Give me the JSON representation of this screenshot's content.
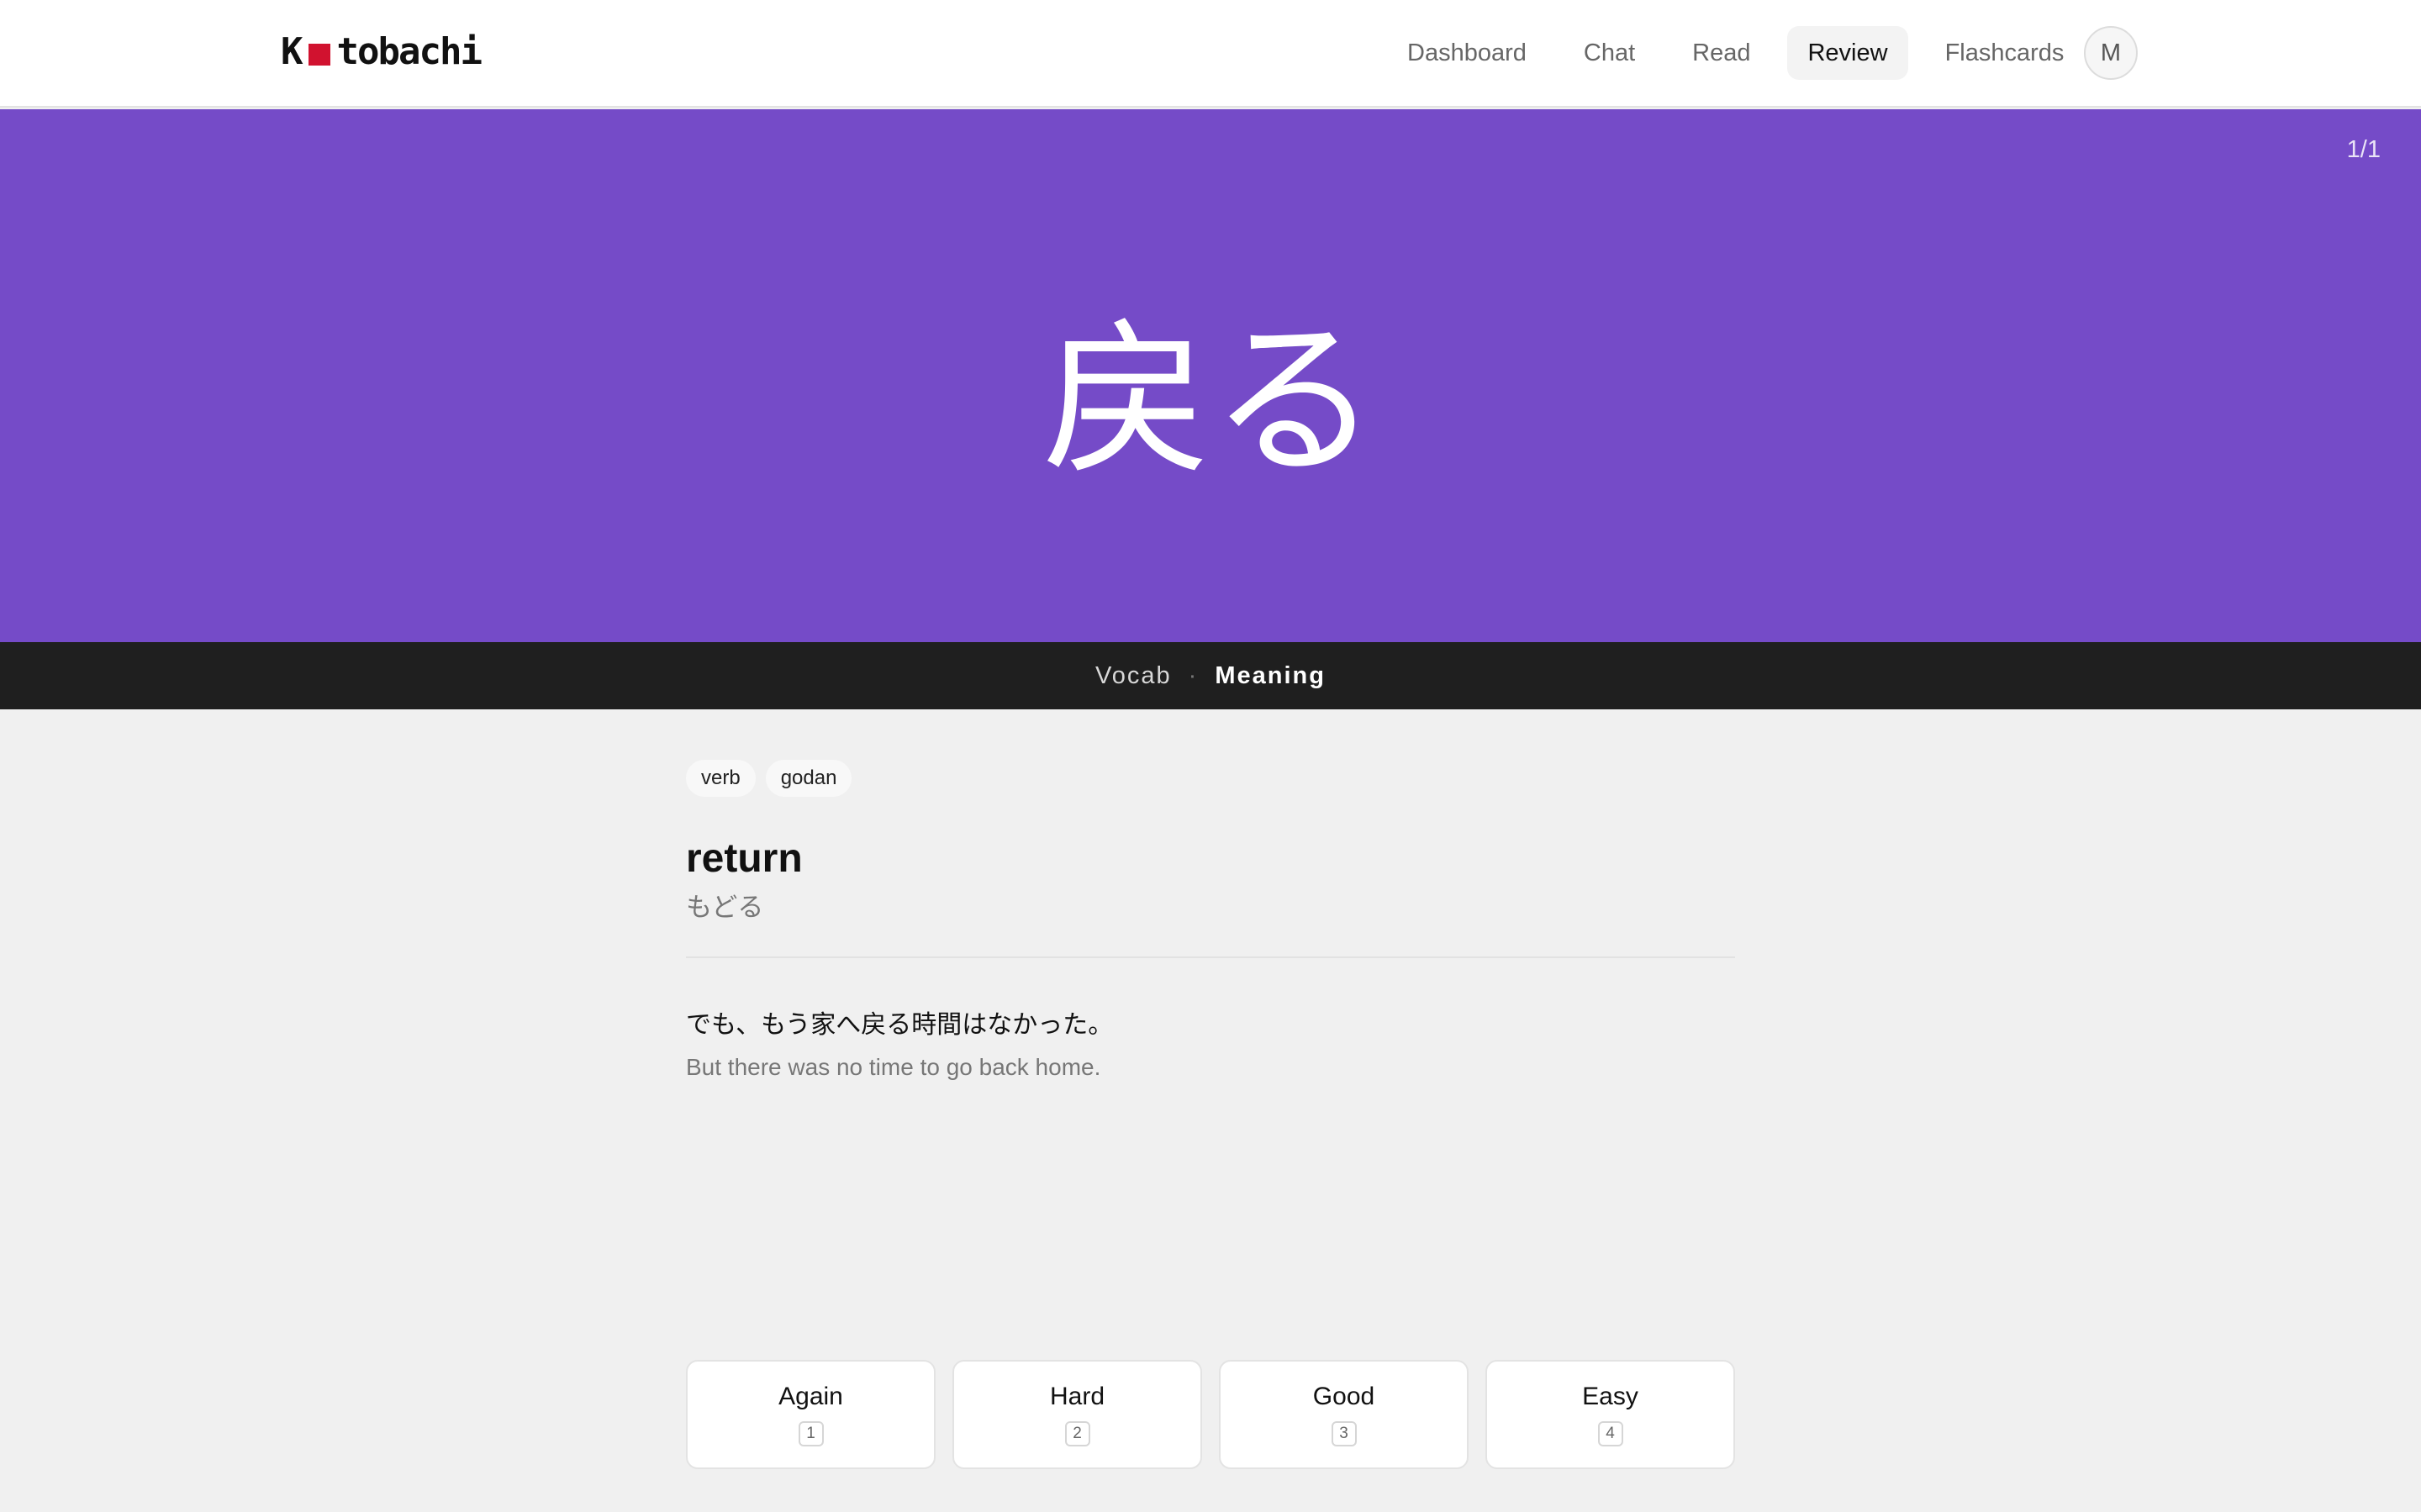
{
  "header": {
    "logo": {
      "text_start": "K",
      "text_end": "tobachi",
      "accent_color": "#d1122f"
    },
    "nav": [
      {
        "label": "Dashboard",
        "active": false
      },
      {
        "label": "Chat",
        "active": false
      },
      {
        "label": "Read",
        "active": false
      },
      {
        "label": "Review",
        "active": true
      },
      {
        "label": "Flashcards",
        "active": false
      }
    ],
    "avatar_initial": "M"
  },
  "hero": {
    "counter": "1/1",
    "word": "戻る",
    "background_color": "#754bc8"
  },
  "typebar": {
    "kind": "Vocab",
    "separator": "·",
    "mode": "Meaning"
  },
  "card": {
    "tags": [
      "verb",
      "godan"
    ],
    "meaning": "return",
    "reading": "もどる",
    "example_jp": "でも、もう家へ戻る時間はなかった。",
    "example_en": "But there was no time to go back home."
  },
  "grades": [
    {
      "label": "Again",
      "key": "1"
    },
    {
      "label": "Hard",
      "key": "2"
    },
    {
      "label": "Good",
      "key": "3"
    },
    {
      "label": "Easy",
      "key": "4"
    }
  ]
}
